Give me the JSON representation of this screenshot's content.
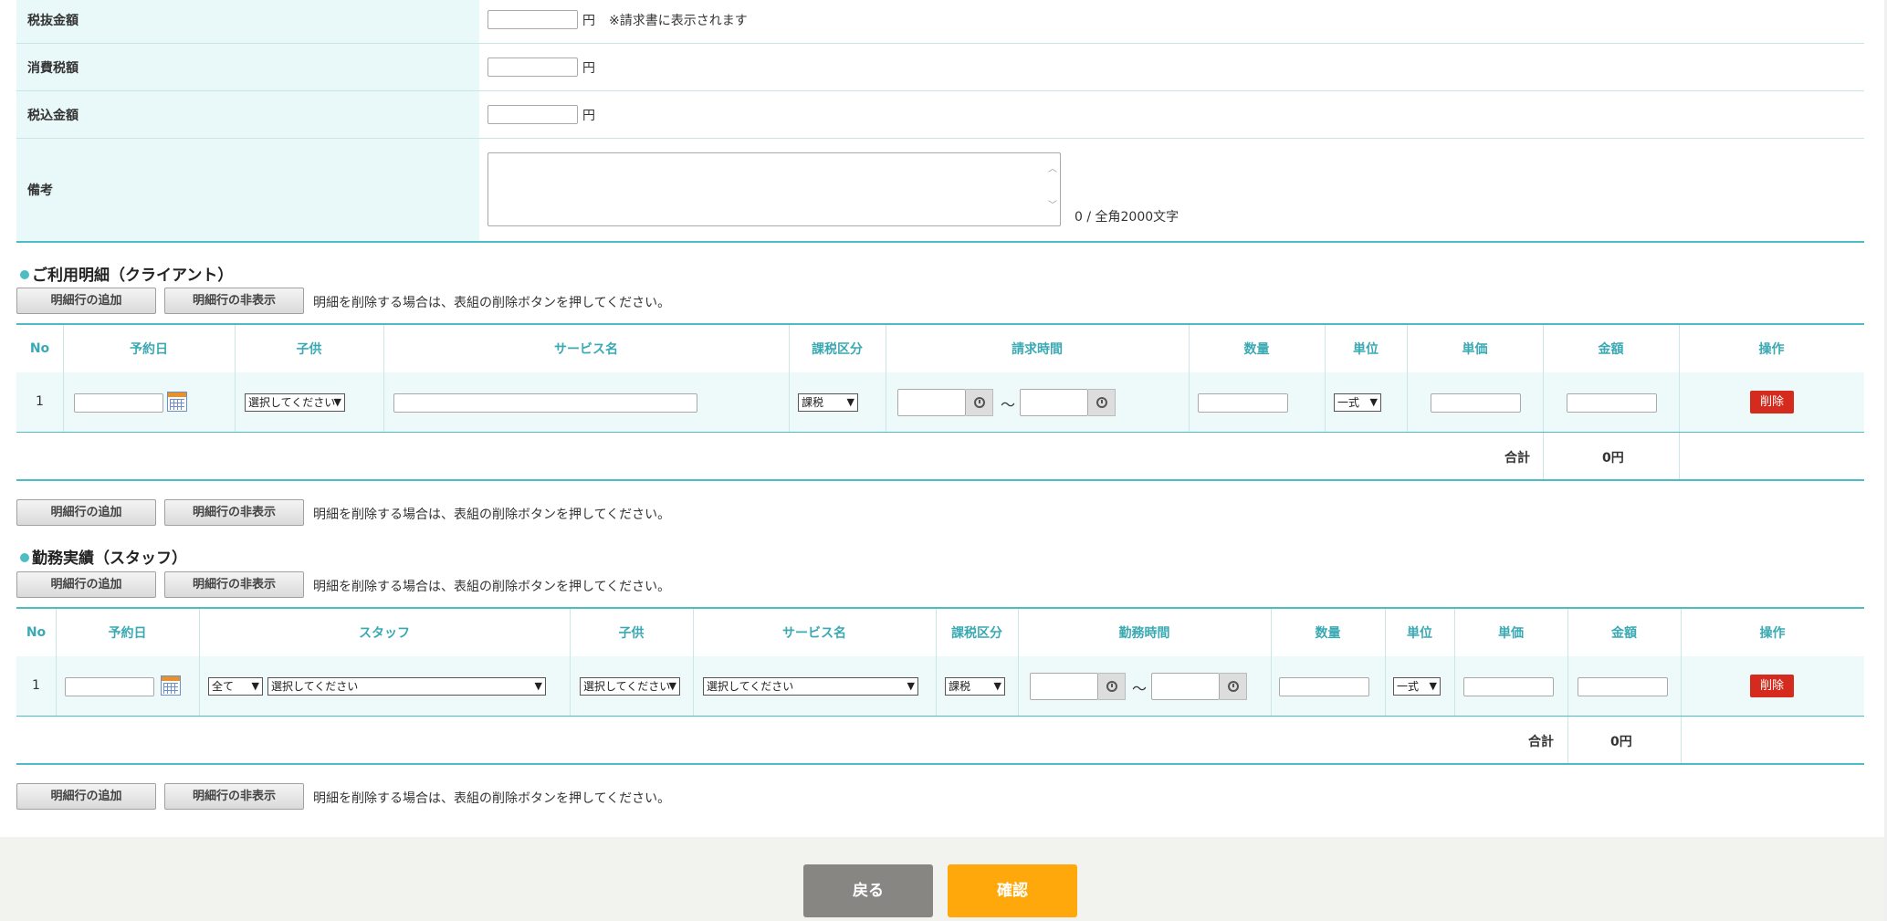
{
  "form": {
    "tax_excl": {
      "label": "税抜金額",
      "unit": "円",
      "note": "※請求書に表示されます"
    },
    "tax": {
      "label": "消費税額",
      "unit": "円"
    },
    "tax_incl": {
      "label": "税込金額",
      "unit": "円"
    },
    "remarks": {
      "label": "備考",
      "counter": "0 / 全角2000文字"
    }
  },
  "client_section": {
    "title": "ご利用明細（クライアント）",
    "add_label": "明細行の追加",
    "hide_label": "明細行の非表示",
    "note": "明細を削除する場合は、表組の削除ボタンを押してください。",
    "headers": [
      "No",
      "予約日",
      "子供",
      "サービス名",
      "課税区分",
      "請求時間",
      "数量",
      "単位",
      "単価",
      "金額",
      "操作"
    ],
    "row": {
      "no": "1",
      "child_select": "選択してください",
      "tax_select": "課税",
      "tilde": "〜",
      "unit_select": "一式",
      "delete_label": "削除"
    },
    "total_label": "合計",
    "total_value": "0円"
  },
  "staff_section": {
    "title": "勤務実績（スタッフ）",
    "add_label": "明細行の追加",
    "hide_label": "明細行の非表示",
    "note": "明細を削除する場合は、表組の削除ボタンを押してください。",
    "headers": [
      "No",
      "予約日",
      "スタッフ",
      "子供",
      "サービス名",
      "課税区分",
      "勤務時間",
      "数量",
      "単位",
      "単価",
      "金額",
      "操作"
    ],
    "row": {
      "no": "1",
      "staff_filter": "全て",
      "staff_select": "選択してください",
      "child_select": "選択してください",
      "service_select": "選択してください",
      "tax_select": "課税",
      "tilde": "〜",
      "unit_select": "一式",
      "delete_label": "削除"
    },
    "total_label": "合計",
    "total_value": "0円"
  },
  "footer": {
    "back_label": "戻る",
    "confirm_label": "確認"
  },
  "colors": {
    "accent": "#4dbdc4",
    "label_bg": "#e9f8f8",
    "delete": "#d52b1e",
    "confirm": "#ffa80b",
    "back": "#888683"
  }
}
